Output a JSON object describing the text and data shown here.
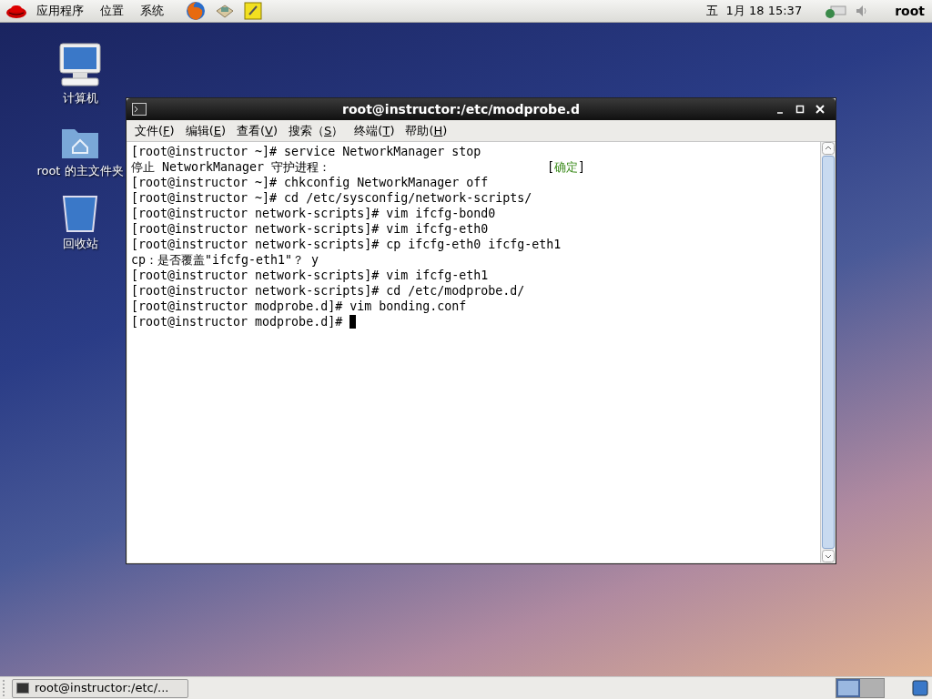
{
  "top_panel": {
    "menus": [
      "应用程序",
      "位置",
      "系统"
    ],
    "clock": "五  1月 18 15:37",
    "user": "root"
  },
  "desktop_icons": [
    {
      "kind": "computer",
      "label": "计算机"
    },
    {
      "kind": "home",
      "label": "root 的主文件夹"
    },
    {
      "kind": "trash",
      "label": "回收站"
    }
  ],
  "window": {
    "title": "root@instructor:/etc/modprobe.d",
    "menu": [
      {
        "before": "文件(",
        "key": "F",
        "after": ")"
      },
      {
        "before": "编辑(",
        "key": "E",
        "after": ")"
      },
      {
        "before": "查看(",
        "key": "V",
        "after": ")"
      },
      {
        "before": "搜索（",
        "key": "S",
        "after": "）"
      },
      {
        "before": "终端(",
        "key": "T",
        "after": ")"
      },
      {
        "before": "帮助(",
        "key": "H",
        "after": ")"
      }
    ],
    "lines": [
      {
        "text": "[root@instructor ~]# service NetworkManager stop"
      },
      {
        "text": "停止 NetworkManager 守护进程：",
        "status_open": "[",
        "status": "确定",
        "status_close": "]"
      },
      {
        "text": "[root@instructor ~]# chkconfig NetworkManager off"
      },
      {
        "text": "[root@instructor ~]# cd /etc/sysconfig/network-scripts/"
      },
      {
        "text": "[root@instructor network-scripts]# vim ifcfg-bond0"
      },
      {
        "text": "[root@instructor network-scripts]# vim ifcfg-eth0"
      },
      {
        "text": "[root@instructor network-scripts]# cp ifcfg-eth0 ifcfg-eth1"
      },
      {
        "text": "cp：是否覆盖\"ifcfg-eth1\"？ y"
      },
      {
        "text": "[root@instructor network-scripts]# vim ifcfg-eth1"
      },
      {
        "text": "[root@instructor network-scripts]# cd /etc/modprobe.d/"
      },
      {
        "text": "[root@instructor modprobe.d]# vim bonding.conf"
      },
      {
        "text": "[root@instructor modprobe.d]# ",
        "cursor": true
      }
    ]
  },
  "taskbar": {
    "tasks": [
      {
        "label": "root@instructor:/etc/...",
        "selected": false
      }
    ],
    "workspaces": [
      {
        "selected": true
      },
      {
        "selected": false
      }
    ]
  }
}
